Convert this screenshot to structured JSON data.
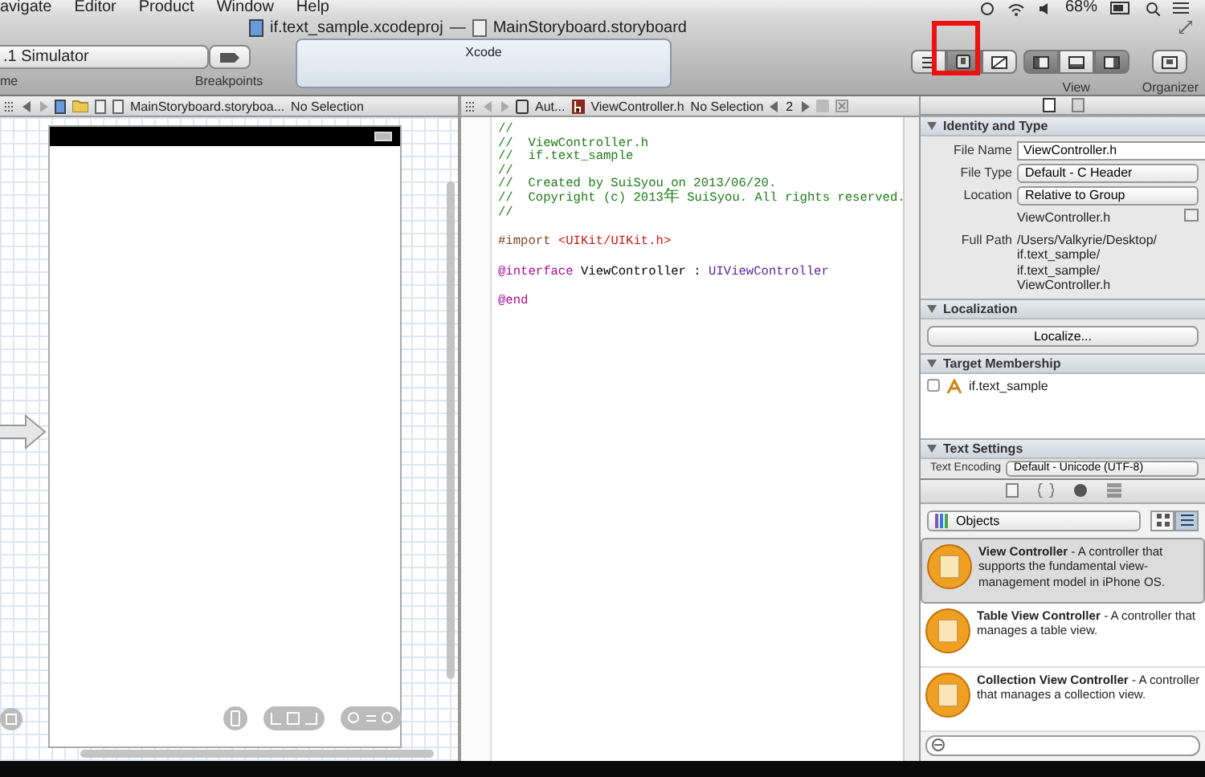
{
  "menu_bar": {
    "items": [
      "avigate",
      "Editor",
      "Product",
      "Window",
      "Help"
    ],
    "battery": "68%"
  },
  "window": {
    "project": "if.text_sample.xcodeproj",
    "separator": "—",
    "file": "MainStoryboard.storyboard"
  },
  "toolbar": {
    "scheme": ".1 Simulator",
    "scheme_label": "me",
    "breakpoints_label": "Breakpoints",
    "activity": "Xcode",
    "editor_modes": [
      {
        "selected": false
      },
      {
        "selected": true
      },
      {
        "selected": false
      }
    ],
    "editor_highlighted": true,
    "view_toggles": [
      {
        "on": true
      },
      {
        "on": false
      },
      {
        "on": true
      }
    ],
    "view_label": "View",
    "organizer_label": "Organizer"
  },
  "left_jump_bar": {
    "file": "MainStoryboard.storyboa...",
    "selection": "No Selection"
  },
  "right_jump_bar": {
    "mode": "Aut...",
    "file": "ViewController.h",
    "selection": "No Selection",
    "counter": "2"
  },
  "code_lines": [
    {
      "tokens": [
        {
          "text": "//",
          "kind": "comment"
        }
      ]
    },
    {
      "tokens": [
        {
          "text": "//  ViewController.h",
          "kind": "comment"
        }
      ]
    },
    {
      "tokens": [
        {
          "text": "//  if.text_sample",
          "kind": "comment"
        }
      ]
    },
    {
      "tokens": [
        {
          "text": "//",
          "kind": "comment"
        }
      ]
    },
    {
      "tokens": [
        {
          "text": "//  Created by SuiSyou on 2013/06/20.",
          "kind": "comment"
        }
      ]
    },
    {
      "tokens": [
        {
          "text": "//  Copyright (c) 2013",
          "kind": "comment"
        },
        {
          "text": "年",
          "kind": "comment",
          "cjk": true
        },
        {
          "text": " SuiSyou. All rights reserved.",
          "kind": "comment"
        }
      ]
    },
    {
      "tokens": [
        {
          "text": "//",
          "kind": "comment"
        }
      ]
    },
    {
      "space_before": true,
      "tokens": [
        {
          "text": "#import ",
          "kind": "directive"
        },
        {
          "text": "<UIKit/UIKit.h>",
          "kind": "string"
        }
      ]
    },
    {
      "space_before": true,
      "tokens": [
        {
          "text": "@interface",
          "kind": "keyword"
        },
        {
          "text": " ViewController : ",
          "kind": "plain"
        },
        {
          "text": "UIViewController",
          "kind": "type"
        }
      ]
    },
    {
      "space_before": true,
      "tokens": [
        {
          "text": "@end",
          "kind": "keyword"
        }
      ]
    }
  ],
  "inspector": {
    "tabs": [
      {
        "selected": true
      },
      {
        "selected": false
      }
    ],
    "identity": {
      "title": "Identity and Type",
      "rows": [
        {
          "kind": "text_field",
          "label": "File Name",
          "value": "ViewController.h"
        },
        {
          "kind": "popup",
          "label": "File Type",
          "value": "Default - C Header"
        },
        {
          "kind": "popup",
          "label": "Location",
          "value": "Relative to Group"
        },
        {
          "kind": "text",
          "value": "ViewController.h"
        },
        {
          "kind": "path",
          "label": "Full Path",
          "lines": [
            "/Users/Valkyrie/Desktop/",
            "if.text_sample/",
            "if.text_sample/",
            "ViewController.h"
          ]
        }
      ]
    },
    "localization": {
      "title": "Localization",
      "button": "Localize..."
    },
    "target_membership": {
      "title": "Target Membership",
      "targets": [
        {
          "name": "if.text_sample",
          "checked": false
        }
      ]
    },
    "text_settings": {
      "title": "Text Settings",
      "label": "Text Encoding",
      "value": "Default - Unicode (UTF-8)"
    }
  },
  "library": {
    "tabs": [
      {
        "selected": false
      },
      {
        "selected": false
      },
      {
        "selected": true
      },
      {
        "selected": false
      }
    ],
    "category": "Objects",
    "list_view": true,
    "items": [
      {
        "title": "View Controller",
        "description": " - A controller that supports the fundamental view-management model in iPhone OS.",
        "selected": true
      },
      {
        "title": "Table View Controller",
        "description": " - A controller that manages a table view.",
        "selected": false
      },
      {
        "title": "Collection View Controller",
        "description": " - A controller that manages a collection view.",
        "selected": false
      }
    ]
  }
}
